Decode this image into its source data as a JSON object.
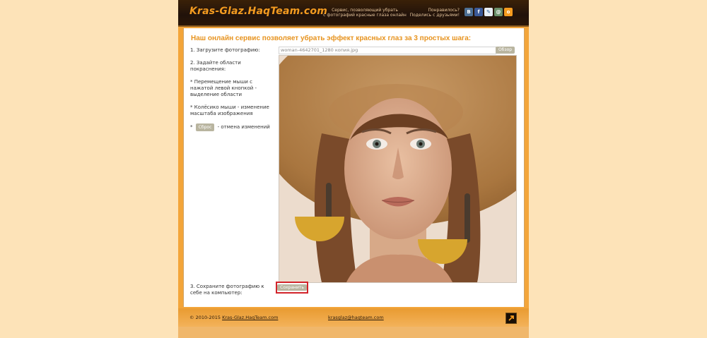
{
  "header": {
    "logo": "Kras-Glaz.HaqTeam.com",
    "tagline_line1": "Сервис, позволяющий убрать",
    "tagline_line2": "с фотографий красные глаза онлайн",
    "like_line1": "Понравилось?",
    "like_line2": "Поделись с друзьями!",
    "social_icons": [
      "vk-icon",
      "facebook-icon",
      "livejournal-icon",
      "mailru-icon",
      "odnoklassniki-icon"
    ]
  },
  "main": {
    "headline": "Наш онлайн сервис позволяет убрать эффект красных глаз за 3 простых шага:",
    "step1": "1. Загрузите фотографию:",
    "step2": "2. Задайте области покраснения:",
    "hint1": "* Перемещение мыши с нажатой левой кнопкой - выделение области",
    "hint2": "* Колёсико мыши - изменение масштаба изображения",
    "hint3_prefix": "*",
    "reset_label": "Сброс",
    "hint3_suffix": "- отмена изменений",
    "file_name": "woman-4642701_1280 копия.jpg",
    "browse_label": "Обзор",
    "step3": "3. Сохраните фотографию к себе на компьютер:",
    "save_label": "Сохранить"
  },
  "footer": {
    "copyright_prefix": "© 2010-2015",
    "copyright_link": "Kras-Glaz.HaqTeam.com",
    "email": "krasglaz@haqteam.com"
  },
  "colors": {
    "page_bg": "#fde3b8",
    "accent": "#f39b20",
    "header_bg": "#21120a",
    "save_highlight": "#d2232a"
  }
}
